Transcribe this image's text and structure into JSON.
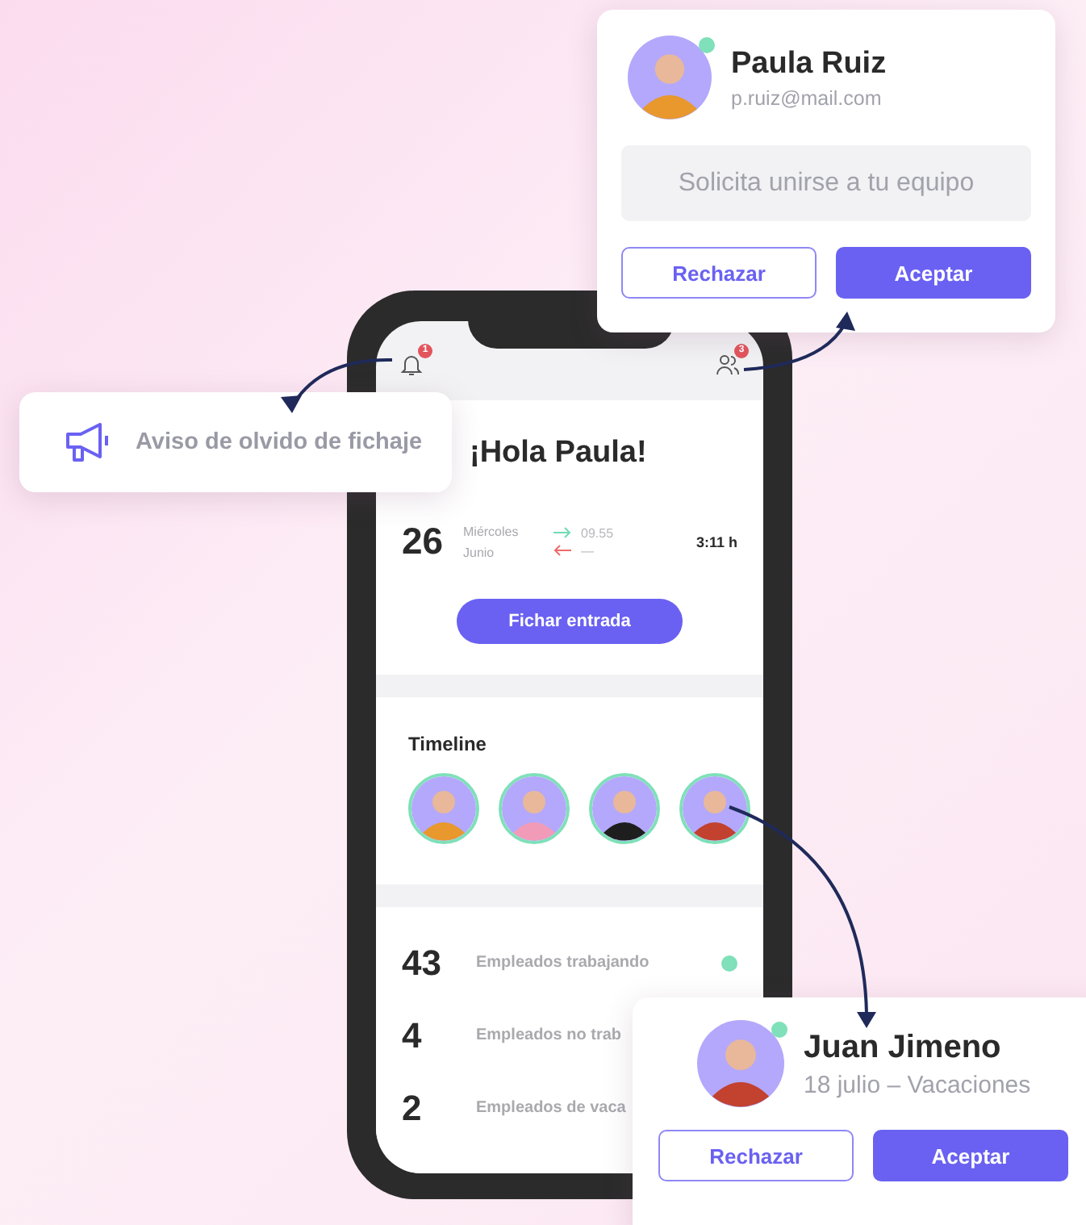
{
  "phone": {
    "header": {
      "bell_badge": "1",
      "people_badge": "3"
    },
    "greeting": "¡Hola Paula!",
    "day": "26",
    "weekday": "Miércoles",
    "month": "Junio",
    "entry_time": "09.55",
    "exit_time": "—",
    "total": "3:11 h",
    "clock_button": "Fichar entrada",
    "timeline": {
      "title": "Timeline",
      "avatars": [
        {
          "color": "#e8982c"
        },
        {
          "color": "#f29bb8"
        },
        {
          "color": "#1e1e1e"
        },
        {
          "color": "#c2412f"
        }
      ]
    },
    "stats": [
      {
        "count": "43",
        "label": "Empleados trabajando",
        "color": "#7fe0b9"
      },
      {
        "count": "4",
        "label": "Empleados no trab"
      },
      {
        "count": "2",
        "label": "Empleados de vaca"
      }
    ]
  },
  "notification_card": {
    "text": "Aviso de olvido de fichaje"
  },
  "request_card": {
    "name": "Paula Ruiz",
    "email": "p.ruiz@mail.com",
    "online": true,
    "message": "Solicita unirse a tu equipo",
    "buttons": [
      {
        "label": "Rechazar",
        "kind": "outline"
      },
      {
        "label": "Aceptar",
        "kind": "primary"
      }
    ]
  },
  "absence_card": {
    "name": "Juan Jimeno",
    "detail": "18 julio – Vacaciones",
    "online": true,
    "buttons": [
      {
        "label": "Rechazar",
        "kind": "outline"
      },
      {
        "label": "Aceptar",
        "kind": "primary"
      }
    ]
  }
}
